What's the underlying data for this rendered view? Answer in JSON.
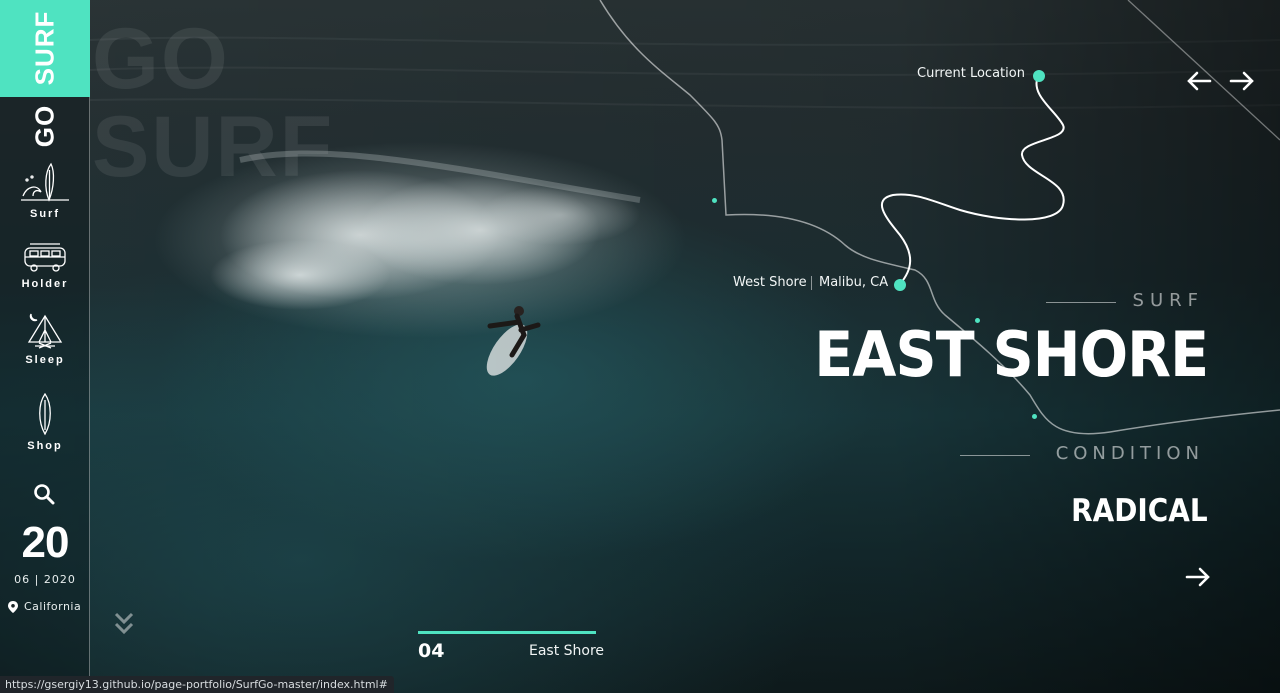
{
  "brand": {
    "surf": "SURF",
    "go": "GO",
    "ghost_go": "GO",
    "ghost_surf": "SURF",
    "accent": "#4fe3c1"
  },
  "nav": {
    "items": [
      {
        "label": "Surf",
        "icon": "surfboard-wave-icon"
      },
      {
        "label": "Holder",
        "icon": "van-icon"
      },
      {
        "label": "Sleep",
        "icon": "tent-icon"
      },
      {
        "label": "Shop",
        "icon": "surfboard-icon"
      }
    ],
    "search_icon": "search-icon"
  },
  "date": {
    "day": "20",
    "month_year": "06 | 2020"
  },
  "location": {
    "label": "California",
    "icon": "map-pin-icon"
  },
  "map": {
    "current_location": "Current Location",
    "west_shore": "West Shore",
    "malibu": "Malibu, CA"
  },
  "slider_nav": {
    "prev_icon": "arrow-left-icon",
    "next_icon": "arrow-right-icon"
  },
  "hero": {
    "kicker": "SURF",
    "title": "EAST SHORE",
    "condition_kicker": "CONDITION",
    "condition_value": "RADICAL",
    "more_icon": "arrow-right-icon"
  },
  "slide": {
    "number": "04",
    "name": "East Shore",
    "progress": 1.0
  },
  "status_url": "https://gsergiy13.github.io/page-portfolio/SurfGo-master/index.html#"
}
